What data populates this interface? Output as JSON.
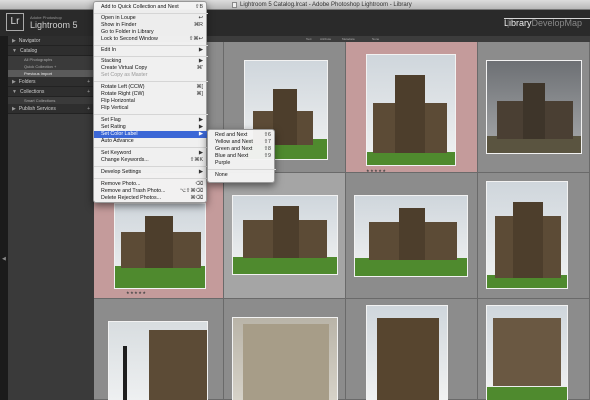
{
  "window": {
    "title": "Lightroom 5 Catalog.lrcat - Adobe Photoshop Lightroom - Library"
  },
  "header": {
    "logo": "Lr",
    "brand_small": "Adobe Photoshop",
    "brand_large": "Lightroom 5",
    "modules": [
      "Library",
      "Develop",
      "Map"
    ],
    "active_module": "Library"
  },
  "left_panel": {
    "navigator": "Navigator",
    "catalog": "Catalog",
    "catalog_items": [
      "All Photographs",
      "Quick Collection +",
      "Previous Import"
    ],
    "folders": "Folders",
    "collections": "Collections",
    "collection_items": [
      "Smart Collections"
    ],
    "publish": "Publish Services"
  },
  "filter_bar": [
    "Text",
    "Attribute",
    "Metadata",
    "None"
  ],
  "menu": {
    "items": [
      {
        "label": "Add to Quick Collection and Next",
        "shortcut": "⇧B"
      },
      {
        "label": "Open in Loupe",
        "shortcut": "↩"
      },
      {
        "label": "Show in Finder",
        "shortcut": "⌘R"
      },
      {
        "label": "Go to Folder in Library",
        "shortcut": ""
      },
      {
        "label": "Lock to Second Window",
        "shortcut": "⇧⌘↩"
      },
      {
        "label": "Edit In",
        "shortcut": "▶"
      },
      {
        "label": "Stacking",
        "shortcut": "▶"
      },
      {
        "label": "Create Virtual Copy",
        "shortcut": "⌘'"
      },
      {
        "label": "Set Copy as Master",
        "shortcut": ""
      },
      {
        "label": "Rotate Left (CCW)",
        "shortcut": "⌘["
      },
      {
        "label": "Rotate Right (CW)",
        "shortcut": "⌘]"
      },
      {
        "label": "Flip Horizontal",
        "shortcut": ""
      },
      {
        "label": "Flip Vertical",
        "shortcut": ""
      },
      {
        "label": "Set Flag",
        "shortcut": "▶"
      },
      {
        "label": "Set Rating",
        "shortcut": "▶"
      },
      {
        "label": "Set Color Label",
        "shortcut": "▶"
      },
      {
        "label": "Auto Advance",
        "shortcut": ""
      },
      {
        "label": "Set Keyword",
        "shortcut": "▶"
      },
      {
        "label": "Change Keywords...",
        "shortcut": "⇧⌘K"
      },
      {
        "label": "Develop Settings",
        "shortcut": "▶"
      },
      {
        "label": "Remove Photo...",
        "shortcut": "⌫"
      },
      {
        "label": "Remove and Trash Photo...",
        "shortcut": "⌥⇧⌘⌫"
      },
      {
        "label": "Delete Rejected Photos...",
        "shortcut": "⌘⌫"
      }
    ]
  },
  "submenu": {
    "items": [
      {
        "label": "Red and Next",
        "shortcut": "⇧6"
      },
      {
        "label": "Yellow and Next",
        "shortcut": "⇧7"
      },
      {
        "label": "Green and Next",
        "shortcut": "⇧8"
      },
      {
        "label": "Blue and Next",
        "shortcut": "⇧9"
      },
      {
        "label": "Purple",
        "shortcut": ""
      },
      {
        "label": "None",
        "shortcut": ""
      }
    ]
  },
  "grid": {
    "stars": "★★★★★"
  },
  "colors": {
    "menu_highlight": "#3b67d6",
    "selected_cell": "#c49b9b"
  }
}
